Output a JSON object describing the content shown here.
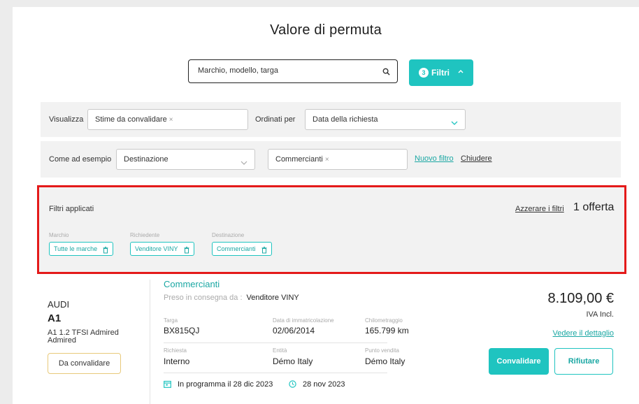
{
  "page": {
    "title": "Valore di permuta"
  },
  "search": {
    "placeholder": "Marchio, modello, targa",
    "icon": "search-icon"
  },
  "filters_button": {
    "count": "3",
    "label": "Filtri"
  },
  "view_row": {
    "view_label": "Visualizza",
    "view_value": "Stime da convalidare",
    "order_label": "Ordinati per",
    "order_value": "Data della richiesta"
  },
  "filter_row": {
    "example_label": "Come ad esempio",
    "field_value": "Destinazione",
    "tag_value": "Commercianti",
    "new_filter": "Nuovo filtro",
    "close": "Chiudere"
  },
  "applied_filters": {
    "title": "Filtri applicati",
    "reset": "Azzerare i filtri",
    "count": "1 offerta",
    "items": [
      {
        "caption": "Marchio",
        "value": "Tutte le marche"
      },
      {
        "caption": "Richiedente",
        "value": "Venditore VINY"
      },
      {
        "caption": "Destinazione",
        "value": "Commercianti"
      }
    ]
  },
  "offer": {
    "brand": "AUDI",
    "model": "A1",
    "variant": "A1 1.2 TFSI Admired Admired",
    "status": "Da convalidare",
    "destination": "Commercianti",
    "taken_by_label": "Preso in consegna da :",
    "taken_by_value": "Venditore VINY",
    "fields": [
      {
        "label": "Targa",
        "value": "BX815QJ"
      },
      {
        "label": "Data di immatricolazione",
        "value": "02/06/2014"
      },
      {
        "label": "Chilometraggio",
        "value": "165.799 km"
      },
      {
        "label": "Richiesta",
        "value": "Interno"
      },
      {
        "label": "Entità",
        "value": "Démo Italy"
      },
      {
        "label": "Punto vendita",
        "value": "Démo Italy"
      }
    ],
    "scheduled": "In programma il 28 dic 2023",
    "date": "28 nov 2023",
    "price": "8.109,00 €",
    "vat": "IVA Incl.",
    "detail_link": "Vedere il dettaglio",
    "validate": "Convalidare",
    "reject": "Rifiutare"
  },
  "colors": {
    "accent": "#1fc4c0",
    "highlight": "#e41a1a",
    "status_border": "#e8c97a"
  }
}
